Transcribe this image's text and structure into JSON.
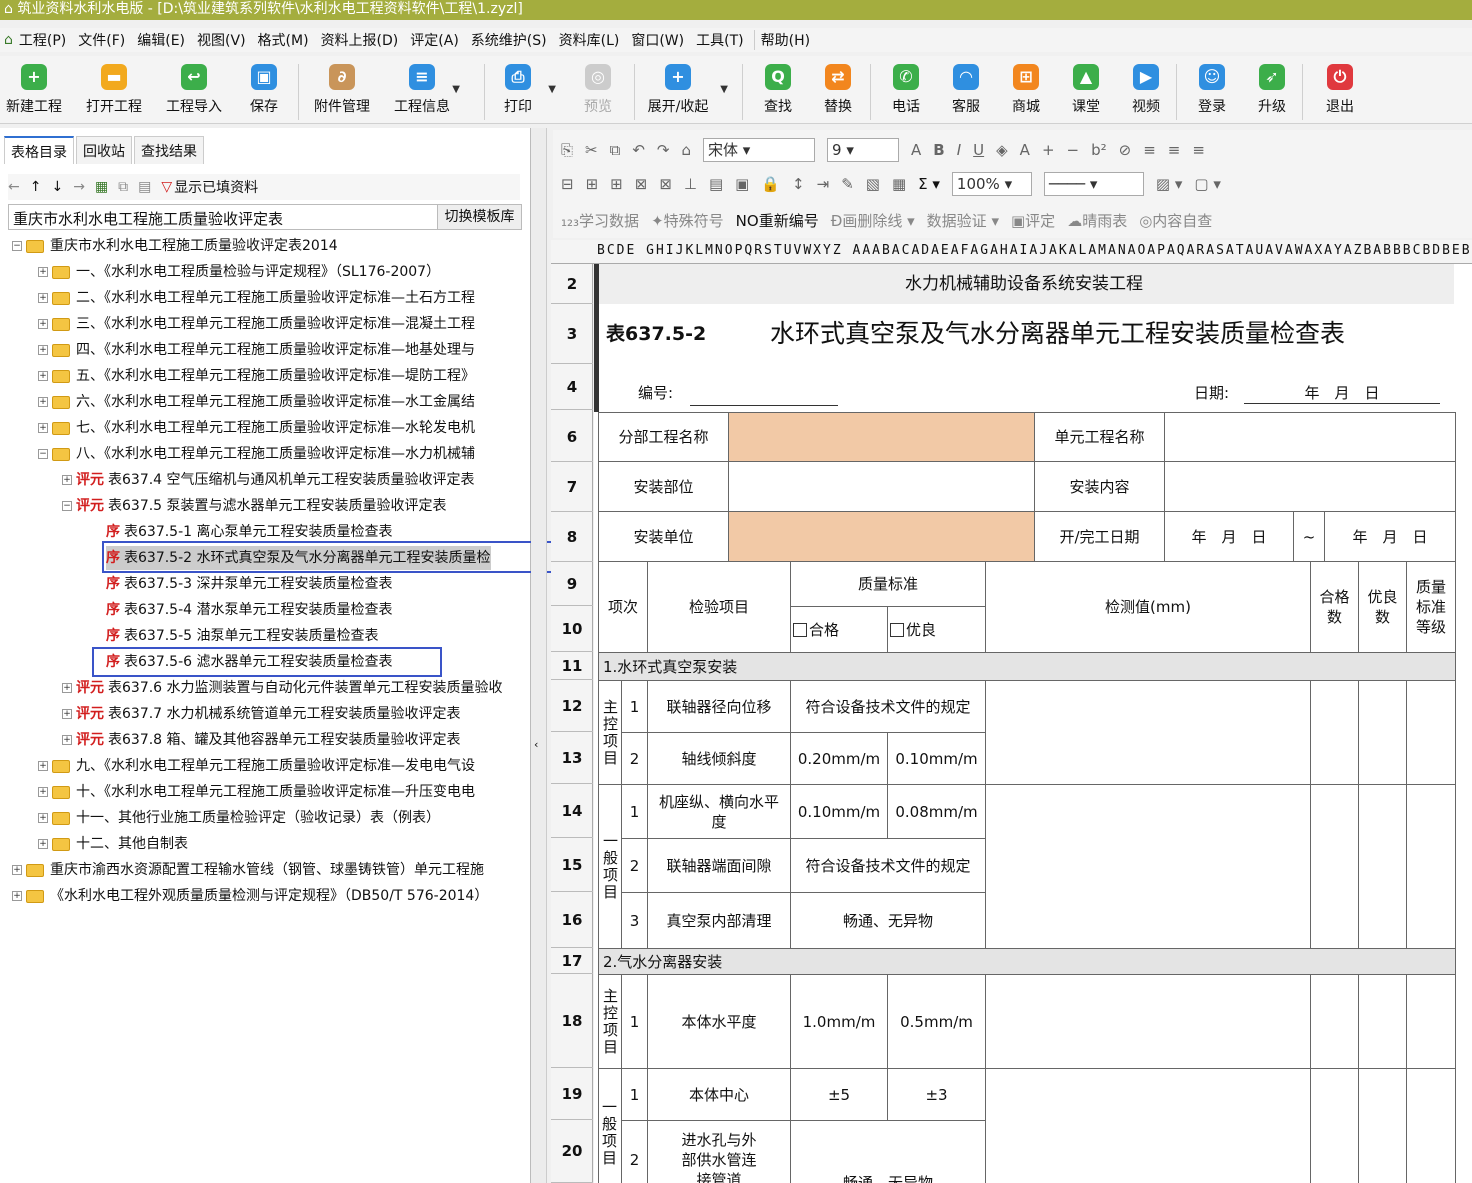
{
  "window": {
    "title": "筑业资料水利水电版 - [D:\\筑业建筑系列软件\\水利水电工程资料软件\\工程\\1.zyzl]"
  },
  "menu": [
    "工程(P)",
    "文件(F)",
    "编辑(E)",
    "视图(V)",
    "格式(M)",
    "资料上报(D)",
    "评定(A)",
    "系统维护(S)",
    "资料库(L)",
    "窗口(W)",
    "工具(T)",
    "帮助(H)"
  ],
  "toolbar": {
    "new": "新建工程",
    "open": "打开工程",
    "import": "工程导入",
    "save": "保存",
    "attach": "附件管理",
    "info": "工程信息",
    "print": "打印",
    "preview": "预览",
    "expand": "展开/收起",
    "find": "查找",
    "replace": "替换",
    "phone": "电话",
    "service": "客服",
    "shop": "商城",
    "class": "课堂",
    "video": "视频",
    "login": "登录",
    "upgrade": "升级",
    "exit": "退出"
  },
  "left": {
    "tabs": [
      "表格目录",
      "回收站",
      "查找结果"
    ],
    "show_filled": "显示已填资料",
    "template_name": "重庆市水利水电工程施工质量验收评定表",
    "switch_btn": "切换模板库",
    "tree": [
      "重庆市水利水电工程施工质量验收评定表2014",
      "一、《水利水电工程质量检验与评定规程》（SL176-2007）",
      "二、《水利水电工程单元工程施工质量验收评定标准—土石方工程",
      "三、《水利水电工程单元工程施工质量验收评定标准—混凝土工程",
      "四、《水利水电工程单元工程施工质量验收评定标准—地基处理与",
      "五、《水利水电工程单元工程施工质量验收评定标准—堤防工程》",
      "六、《水利水电工程单元工程施工质量验收评定标准—水工金属结",
      "七、《水利水电工程单元工程施工质量验收评定标准—水轮发电机",
      "八、《水利水电工程单元工程施工质量验收评定标准—水力机械辅",
      "表637.4 空气压缩机与通风机单元工程安装质量验收评定表",
      "表637.5 泵装置与滤水器单元工程安装质量验收评定表",
      "表637.5-1 离心泵单元工程安装质量检查表",
      "表637.5-2 水环式真空泵及气水分离器单元工程安装质量检",
      "表637.5-3 深井泵单元工程安装质量检查表",
      "表637.5-4 潜水泵单元工程安装质量检查表",
      "表637.5-5 油泵单元工程安装质量检查表",
      "表637.5-6 滤水器单元工程安装质量检查表",
      "表637.6 水力监测装置与自动化元件装置单元工程安装质量验收",
      "表637.7 水力机械系统管道单元工程安装质量验收评定表",
      "表637.8 箱、罐及其他容器单元工程安装质量验收评定表",
      "九、《水利水电工程单元工程施工质量验收评定标准—发电电气设",
      "十、《水利水电工程单元工程施工质量验收评定标准—升压变电电",
      "十一、其他行业施工质量检验评定（验收记录）表（例表）",
      "十二、其他自制表",
      "重庆市渝西水资源配置工程输水管线（钢管、球墨铸铁管）单元工程施",
      "《水利水电工程外观质量质量检测与评定规程》（DB50/T 576-2014）"
    ],
    "tag_doc": "序",
    "tag_eval": "评",
    "tag_unit": "元"
  },
  "format_bar": {
    "font": "宋体",
    "size": "9",
    "zoom": "100%",
    "b": "B",
    "i": "I",
    "u": "U",
    "row3": [
      "学习数据",
      "特殊符号",
      "重新编号",
      "画删除线",
      "数据验证",
      "评定",
      "晴雨表",
      "内容自查"
    ]
  },
  "columns": "BCDE GHIJKLMNOPQRSTUVWXYZ AAABACADAEAFAGAHAIAJAKALAMANAOAPAQARASATAUAVAWAXAYAZBABBBCBDBEBF",
  "rows": [
    "2",
    "3",
    "4",
    "6",
    "7",
    "8",
    "9",
    "10",
    "11",
    "12",
    "13",
    "14",
    "15",
    "16",
    "17",
    "18",
    "19",
    "20"
  ],
  "sheet": {
    "project_type": "水力机械辅助设备系统安装工程",
    "table_no": "表637.5-2",
    "table_title": "水环式真空泵及气水分离器单元工程安装质量检查表",
    "number_label": "编号:",
    "date_label": "日期:",
    "date_value": "年　月　日",
    "sub_project": "分部工程名称",
    "unit_project": "单元工程名称",
    "install_part": "安装部位",
    "install_content": "安装内容",
    "install_unit": "安装单位",
    "start_end": "开/完工日期",
    "ymd": "年　月　日",
    "tilde": "~",
    "col_item": "项次",
    "col_check": "检验项目",
    "col_std": "质量标准",
    "col_pass": "合格",
    "col_excellent": "优良",
    "col_measure": "检测值(mm)",
    "col_pass_count": "合格数",
    "col_excel_count": "优良数",
    "col_grade": "质量标准等级",
    "sec1": "1.水环式真空泵安装",
    "sec2": "2.气水分离器安装",
    "main_item": "主控项目",
    "general_item": "一般项目",
    "r12": {
      "n": "1",
      "name": "联轴器径向位移",
      "std": "符合设备技术文件的规定"
    },
    "r13": {
      "n": "2",
      "name": "轴线倾斜度",
      "pass": "0.20mm/m",
      "exc": "0.10mm/m"
    },
    "r14": {
      "n": "1",
      "name": "机座纵、横向水平度",
      "pass": "0.10mm/m",
      "exc": "0.08mm/m"
    },
    "r15": {
      "n": "2",
      "name": "联轴器端面间隙",
      "std": "符合设备技术文件的规定"
    },
    "r16": {
      "n": "3",
      "name": "真空泵内部清理",
      "std": "畅通、无异物"
    },
    "r18": {
      "n": "1",
      "name": "本体水平度",
      "pass": "1.0mm/m",
      "exc": "0.5mm/m"
    },
    "r19": {
      "n": "1",
      "name": "本体中心",
      "pass": "±5",
      "exc": "±3"
    },
    "r20": {
      "n": "2",
      "name": "进水孔与外部供水管连接管道",
      "std": "畅通、无异物"
    }
  },
  "colors": {
    "title_bar": "#a4ad3e",
    "peach": "#f2c9a6",
    "highlight": "#3a54c8"
  }
}
